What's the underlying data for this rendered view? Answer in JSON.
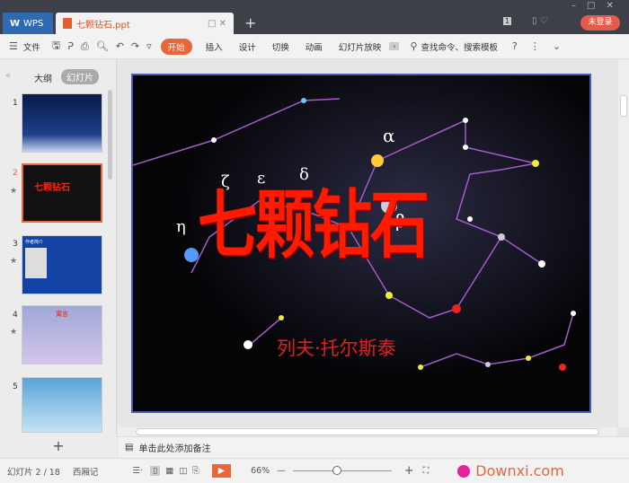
{
  "app": {
    "name": "WPS",
    "login": "未登录",
    "window_badge": "1"
  },
  "tab": {
    "title": "七颗钻石.ppt",
    "new_tab": "+"
  },
  "toolbar": {
    "file": "文件",
    "menus": [
      "开始",
      "插入",
      "设计",
      "切换",
      "动画",
      "幻灯片放映"
    ],
    "search": "查找命令、搜索模板",
    "help": "?"
  },
  "left_panel": {
    "tabs": [
      "大纲",
      "幻灯片"
    ],
    "slides": [
      {
        "num": "1"
      },
      {
        "num": "2",
        "title": "七颗钻石"
      },
      {
        "num": "3",
        "title": "作者简介"
      },
      {
        "num": "4",
        "title": "寓言"
      },
      {
        "num": "5"
      }
    ],
    "add": "+"
  },
  "slide": {
    "title": "七颗钻石",
    "author": "列夫·托尔斯泰",
    "greek": [
      "α",
      "β",
      "δ",
      "ε",
      "ζ",
      "η"
    ]
  },
  "notes": {
    "placeholder": "单击此处添加备注"
  },
  "status": {
    "slide_indicator": "幻灯片 2 / 18",
    "theme": "西厢记",
    "zoom": "66%",
    "zoom_fraction": 0.45,
    "watermark": "Downxi.com"
  },
  "colors": {
    "accent": "#e8663a",
    "title_red": "#ff1a00",
    "slide_border": "#4a5ab8"
  }
}
